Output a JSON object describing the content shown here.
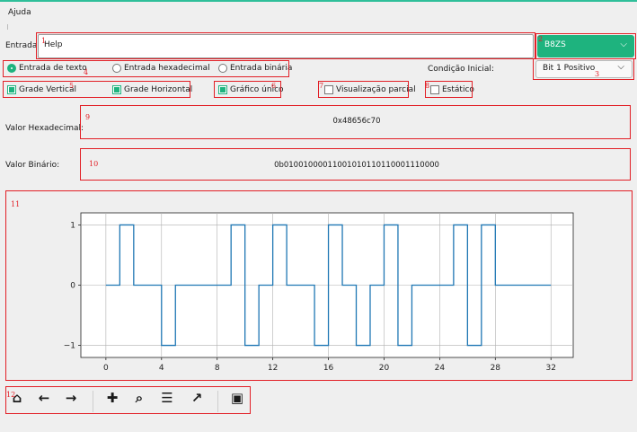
{
  "menu": {
    "help": "Ajuda"
  },
  "input": {
    "label": "Entrada:",
    "value": "Help"
  },
  "encoding": {
    "selected": "B8ZS"
  },
  "mode": {
    "options": [
      "Entrada de texto",
      "Entrada hexadecimal",
      "Entrada binária"
    ],
    "selected_index": 0
  },
  "initial": {
    "label": "Condição Inicial:",
    "selected": "Bit 1 Positivo"
  },
  "checks": [
    {
      "label": "Grade Vertical",
      "checked": true
    },
    {
      "label": "Grade Horizontal",
      "checked": true
    },
    {
      "label": "Gráfico único",
      "checked": true
    },
    {
      "label": "Visualização parcial",
      "checked": false
    },
    {
      "label": "Estático",
      "checked": false
    }
  ],
  "hex": {
    "label": "Valor Hexadecimal:",
    "value": "0x48656c70"
  },
  "bin": {
    "label": "Valor Binário:",
    "value": "0b01001000011001010110110001110000"
  },
  "markers": [
    "1",
    "2",
    "3",
    "4",
    "5",
    "6",
    "7",
    "8",
    "9",
    "10",
    "11",
    "12"
  ],
  "toolbar": {
    "icons": [
      "home-icon",
      "back-icon",
      "forward-icon",
      "pan-icon",
      "zoom-icon",
      "configure-subplots-icon",
      "edit-axis-icon",
      "save-icon"
    ]
  },
  "colors": {
    "accent": "#1eb37e",
    "annotation": "#e21f26",
    "line": "#1f77b4"
  },
  "chart_data": {
    "type": "line",
    "step": true,
    "x_ticks": [
      0,
      4,
      8,
      12,
      16,
      20,
      24,
      28,
      32
    ],
    "y_ticks": [
      1,
      0,
      -1
    ],
    "y_tick_labels": [
      "1",
      "0",
      "−1"
    ],
    "xlim": [
      -1.8,
      33.6
    ],
    "ylim": [
      -1.2,
      1.2
    ],
    "grid": true,
    "x": [
      0,
      1,
      2,
      3,
      4,
      5,
      6,
      7,
      8,
      9,
      10,
      11,
      12,
      13,
      14,
      15,
      16,
      17,
      18,
      19,
      20,
      21,
      22,
      23,
      24,
      25,
      26,
      27,
      28,
      29,
      30,
      31,
      32
    ],
    "values": [
      0,
      1,
      0,
      0,
      -1,
      0,
      0,
      0,
      0,
      1,
      -1,
      0,
      1,
      0,
      0,
      -1,
      1,
      0,
      -1,
      0,
      1,
      -1,
      0,
      0,
      0,
      1,
      -1,
      1,
      0,
      0,
      0,
      0,
      0
    ]
  }
}
